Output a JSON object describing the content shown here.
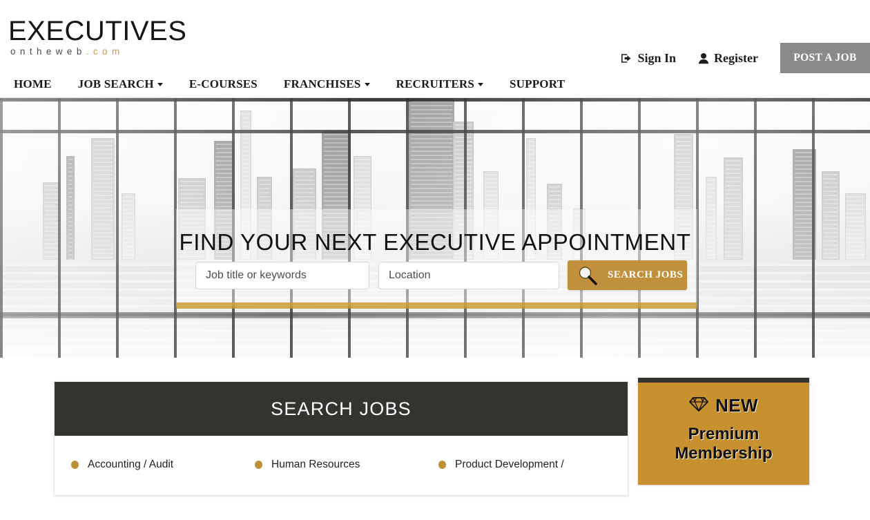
{
  "header": {
    "logo": {
      "main": "EXECUTIVES",
      "sub": "ontheweb",
      "dotcom": ".com"
    },
    "top_links": [
      {
        "label": "Sign In",
        "icon": "sign-in-icon"
      },
      {
        "label": "Register",
        "icon": "user-icon"
      }
    ],
    "post_job_label": "POST A JOB",
    "nav": [
      {
        "label": "HOME",
        "caret": false
      },
      {
        "label": "JOB SEARCH",
        "caret": true
      },
      {
        "label": "E-COURSES",
        "caret": false
      },
      {
        "label": "FRANCHISES",
        "caret": true
      },
      {
        "label": "RECRUITERS",
        "caret": true
      },
      {
        "label": "SUPPORT",
        "caret": false
      }
    ]
  },
  "hero": {
    "title": "FIND YOUR NEXT EXECUTIVE APPOINTMENT",
    "keyword_placeholder": "Job title or keywords",
    "keyword_value": "",
    "location_placeholder": "Location",
    "location_value": "",
    "search_button_label": "SEARCH JOBS",
    "search_icon": "magnifier-icon"
  },
  "jobs_panel": {
    "heading": "SEARCH JOBS",
    "categories": [
      "Accounting / Audit",
      "Human Resources",
      "Product Development /"
    ]
  },
  "premium": {
    "badge_icon": "gem-icon",
    "badge_label": "NEW",
    "title": "Premium Membership"
  },
  "colors": {
    "gold": "#c8912f",
    "gold_button": "#c1903c",
    "dark": "#333330",
    "gray_button": "#8a8a8a",
    "bullet_gold": "#bd9036"
  }
}
